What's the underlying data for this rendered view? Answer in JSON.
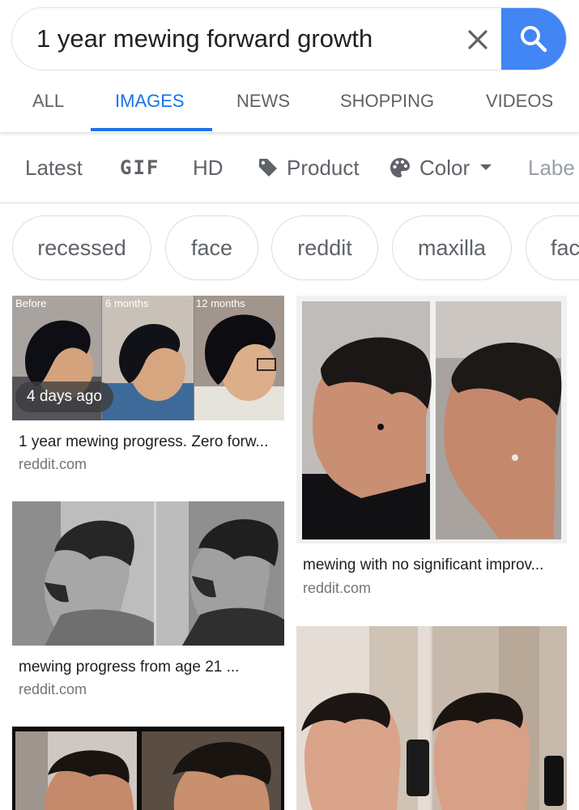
{
  "search": {
    "query": "1 year mewing forward growth"
  },
  "tabs": [
    {
      "label": "ALL"
    },
    {
      "label": "IMAGES"
    },
    {
      "label": "NEWS"
    },
    {
      "label": "SHOPPING"
    },
    {
      "label": "VIDEOS"
    }
  ],
  "active_tab": "IMAGES",
  "filters": [
    {
      "label": "Latest"
    },
    {
      "label": "GIF"
    },
    {
      "label": "HD"
    },
    {
      "label": "Product",
      "icon": "tag-icon"
    },
    {
      "label": "Color",
      "icon": "palette-icon"
    },
    {
      "label": "Labe"
    }
  ],
  "chips": [
    {
      "label": "recessed"
    },
    {
      "label": "face"
    },
    {
      "label": "reddit"
    },
    {
      "label": "maxilla"
    },
    {
      "label": "fac"
    }
  ],
  "results": [
    {
      "title": "1 year mewing progress. Zero forw...",
      "source": "reddit.com",
      "badge": "4 days ago",
      "panel_labels": [
        "Before",
        "6 months",
        "12 months"
      ]
    },
    {
      "title": "mewing with no significant improv...",
      "source": "reddit.com"
    },
    {
      "title": "mewing progress from age 21 ...",
      "source": "reddit.com"
    },
    {},
    {}
  ],
  "colors": {
    "accent": "#1a73e8",
    "search_button": "#4285f4",
    "muted_text": "#5f6368",
    "source_text": "#70757a",
    "border": "#dadce0"
  }
}
